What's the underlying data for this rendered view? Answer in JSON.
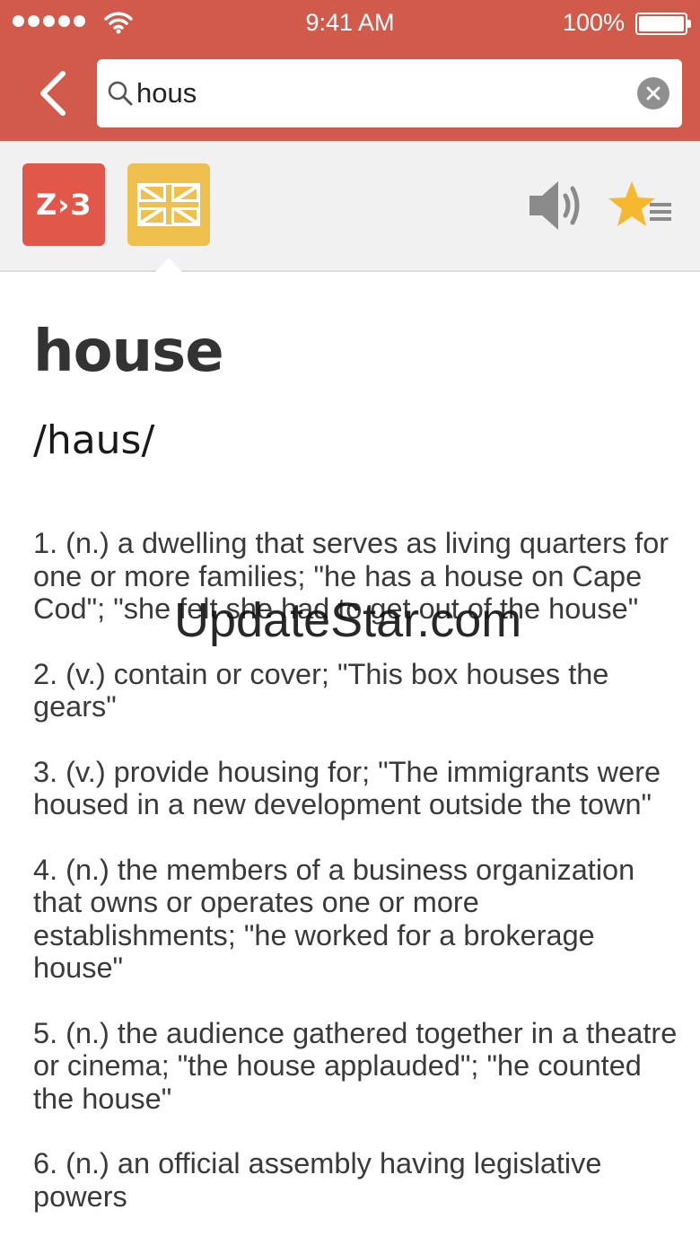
{
  "status_bar": {
    "time": "9:41 AM",
    "battery_percent": "100%",
    "signal_dots": 5
  },
  "search": {
    "query": "hous",
    "icon": "search-icon"
  },
  "toolbar": {
    "chinese_tile_label": "Z›З",
    "uk_tile_icon": "uk-flag-icon",
    "speaker_icon": "speaker-icon",
    "favorite_icon": "star-list-icon"
  },
  "entry": {
    "word": "house",
    "pronunciation": "/haus/",
    "definitions": [
      "1. (n.) a dwelling that serves as living quarters for one or more families; \"he has a house on Cape Cod\"; \"she felt she had to get out of the house\"",
      "2. (v.) contain or cover; \"This box houses the gears\"",
      "3. (v.) provide housing for; \"The immigrants were housed in a new development outside the town\"",
      "4. (n.) the members of a business organization that owns or operates one or more establishments; \"he worked for a brokerage house\"",
      "5. (n.) the audience gathered together in a theatre or cinema; \"the house applauded\"; \"he counted the house\"",
      "6. (n.) an official assembly having legislative powers"
    ]
  },
  "watermark": "UpdateStar.com",
  "colors": {
    "header": "#d25a4b",
    "chinese_tile": "#e1574a",
    "uk_tile": "#f0c04e",
    "star": "#f5b82e"
  }
}
